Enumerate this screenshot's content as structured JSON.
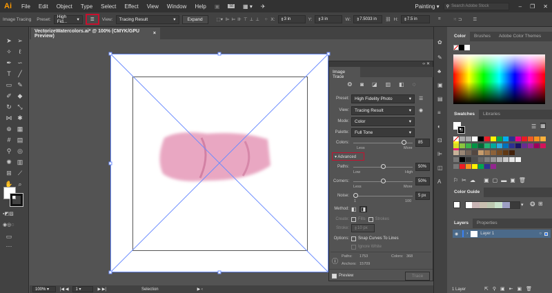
{
  "app": {
    "logo": "Ai",
    "workspace": "Painting",
    "search_placeholder": "Search Adobe Stock"
  },
  "menu": [
    "File",
    "Edit",
    "Object",
    "Type",
    "Select",
    "Effect",
    "View",
    "Window",
    "Help"
  ],
  "control": {
    "mode_label": "Image Tracing",
    "preset_label": "Preset:",
    "preset_value": "High Fid...",
    "view_label": "View:",
    "view_value": "Tracing Result",
    "expand": "Expand",
    "x_label": "X:",
    "x_value": "3 in",
    "y_label": "Y:",
    "y_value": "3 in",
    "w_label": "W:",
    "w_value": "7.5033 in",
    "h_label": "H:",
    "h_value": "7.5 in",
    "highlight_color": "#c8102e"
  },
  "document": {
    "tab_title": "VectorizeWatercolors.ai* @ 100% (CMYK/GPU Preview)",
    "close": "×"
  },
  "image_trace": {
    "title": "Image Trace",
    "preset_label": "Preset:",
    "preset": "High Fidelity Photo",
    "view_label": "View:",
    "view": "Tracing Result",
    "mode_label": "Mode:",
    "mode": "Color",
    "palette_label": "Palette:",
    "palette": "Full Tone",
    "colors_label": "Colors:",
    "colors_value": "85",
    "colors_level": 85,
    "colors_min": "Less",
    "colors_max": "More",
    "advanced": "Advanced",
    "paths_label": "Paths:",
    "paths_value": "50%",
    "paths_level": 50,
    "paths_min": "Low",
    "paths_max": "High",
    "corners_label": "Corners:",
    "corners_value": "50%",
    "corners_level": 50,
    "corners_min": "Less",
    "corners_max": "More",
    "noise_label": "Noise:",
    "noise_value": "5 px",
    "noise_level": 5,
    "noise_min": "1",
    "noise_max": "100",
    "method_label": "Method:",
    "create_label": "Create:",
    "fills": "Fills",
    "strokes": "Strokes",
    "stroke_label": "Stroke:",
    "stroke_value": "10 px",
    "options_label": "Options:",
    "snap": "Snap Curves To Lines",
    "ignore_white": "Ignore White",
    "stat_paths_label": "Paths:",
    "stat_paths": "1753",
    "stat_colors_label": "Colors:",
    "stat_colors": "368",
    "stat_anchors_label": "Anchors:",
    "stat_anchors": "15709",
    "preview": "Preview",
    "trace": "Trace"
  },
  "color_panel": {
    "tabs": [
      "Color",
      "Brushes",
      "Adobe Color Themes"
    ]
  },
  "swatches_panel": {
    "tabs": [
      "Swatches",
      "Libraries"
    ],
    "row1": [
      "#000000",
      "#ed1c24",
      "#fff200",
      "#00a651",
      "#00aeef",
      "#2e3192",
      "#ec008c",
      "#ed1c24",
      "#f15a24",
      "#f7931e",
      "#fbb03b",
      "#fcee21"
    ],
    "row2": [
      "#d9e021",
      "#8cc63f",
      "#39b54a",
      "#009245",
      "#006837",
      "#22b573",
      "#00a99d",
      "#29abe2",
      "#0071bc",
      "#2e3192",
      "#1b1464",
      "#662d91",
      "#93278f",
      "#9e005d",
      "#d4145a",
      "#ed1e79"
    ],
    "row3": [
      "#c7b299",
      "#998675",
      "#736357",
      "#534741",
      "#c69c6d",
      "#a67c52",
      "#8c6239",
      "#754c24",
      "#603813",
      "#42210b"
    ],
    "row4": [
      "#000000",
      "#333333",
      "#4d4d4d",
      "#666666",
      "#808080",
      "#999999",
      "#b3b3b3",
      "#cccccc",
      "#e6e6e6",
      "#f2f2f2"
    ],
    "row5": [
      "#ed1c24",
      "#f7931e",
      "#fff200",
      "#00a651",
      "#2e3192",
      "#93278f"
    ]
  },
  "color_guide": {
    "title": "Color Guide",
    "harmony": [
      "#c8b4b4",
      "#c8bfb0",
      "#bcc8b0",
      "#c9e3cc",
      "#9d9fc4"
    ]
  },
  "layers_panel": {
    "tabs": [
      "Layers",
      "Properties"
    ],
    "layer_name": "Layer 1",
    "count": "1 Layer"
  },
  "status": {
    "zoom": "100%",
    "artboard": "1",
    "tool": "Selection"
  }
}
